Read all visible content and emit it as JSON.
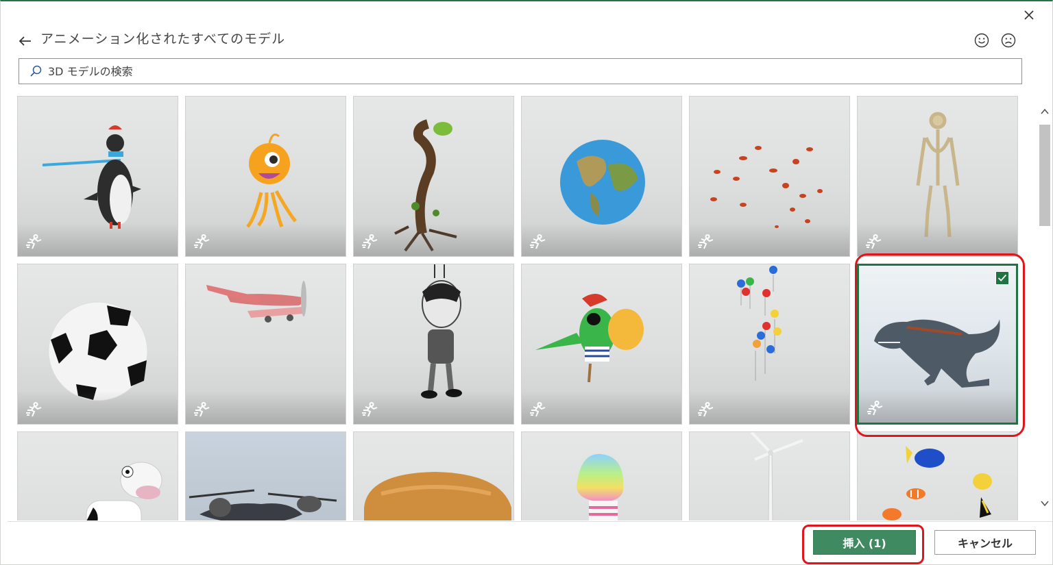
{
  "dialog": {
    "title": "アニメーション化されたすべてのモデル",
    "accent_color": "#217346",
    "highlight_color": "#e0141c"
  },
  "search": {
    "placeholder": "3D モデルの検索",
    "value": ""
  },
  "icons": {
    "close": "close-icon",
    "back": "arrow-left-icon",
    "smile": "smiley-face-icon",
    "frown": "frown-face-icon",
    "search": "search-icon",
    "animated": "running-person-icon",
    "checkmark": "check-icon"
  },
  "models": [
    {
      "name": "penguin",
      "animated": true,
      "selected": false
    },
    {
      "name": "alien",
      "animated": true,
      "selected": false
    },
    {
      "name": "plant",
      "animated": true,
      "selected": false
    },
    {
      "name": "globe",
      "animated": true,
      "selected": false
    },
    {
      "name": "leaves",
      "animated": true,
      "selected": false
    },
    {
      "name": "skeleton",
      "animated": true,
      "selected": false
    },
    {
      "name": "soccer-ball",
      "animated": true,
      "selected": false
    },
    {
      "name": "airplane",
      "animated": true,
      "selected": false
    },
    {
      "name": "cartoon-character",
      "animated": true,
      "selected": false
    },
    {
      "name": "parrot",
      "animated": true,
      "selected": false
    },
    {
      "name": "balloons",
      "animated": true,
      "selected": false
    },
    {
      "name": "t-rex",
      "animated": true,
      "selected": true
    },
    {
      "name": "cow",
      "animated": true,
      "selected": false
    },
    {
      "name": "helicopter",
      "animated": true,
      "selected": false
    },
    {
      "name": "bread",
      "animated": true,
      "selected": false
    },
    {
      "name": "ice-cream",
      "animated": true,
      "selected": false
    },
    {
      "name": "wind-turbine",
      "animated": true,
      "selected": false
    },
    {
      "name": "fish",
      "animated": true,
      "selected": false
    }
  ],
  "footer": {
    "insert_label": "挿入 (1)",
    "cancel_label": "キャンセル"
  }
}
